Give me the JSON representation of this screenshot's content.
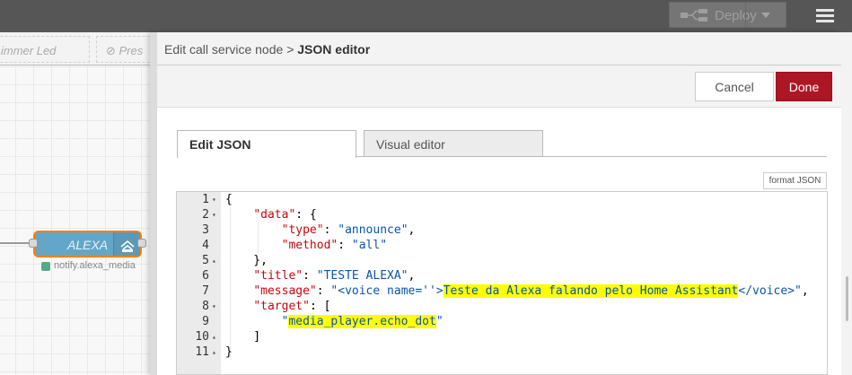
{
  "header": {
    "deploy_label": "Deploy"
  },
  "workspace": {
    "tabs": [
      "immer Led",
      "Pres"
    ],
    "node": {
      "label": "ALEXA",
      "status": "notify.alexa_media"
    }
  },
  "tray": {
    "breadcrumb_prefix": "Edit call service node",
    "breadcrumb_sep": ">",
    "breadcrumb_current": "JSON editor",
    "cancel_label": "Cancel",
    "done_label": "Done",
    "tabs": [
      {
        "label": "Edit JSON",
        "active": true
      },
      {
        "label": "Visual editor",
        "active": false
      }
    ],
    "format_label": "format JSON"
  },
  "editor": {
    "lines": [
      {
        "num": "1",
        "fold": "▾",
        "text": "{"
      },
      {
        "num": "2",
        "fold": "▾",
        "text": "    \"data\": {"
      },
      {
        "num": "3",
        "fold": "",
        "text": "        \"type\": \"announce\","
      },
      {
        "num": "4",
        "fold": "",
        "text": "        \"method\": \"all\""
      },
      {
        "num": "5",
        "fold": "▴",
        "text": "    },"
      },
      {
        "num": "6",
        "fold": "",
        "text": "    \"title\": \"TESTE ALEXA\","
      },
      {
        "num": "7",
        "fold": "",
        "text": "    \"message\": \"<voice name=''>Teste da Alexa falando pelo Home Assistant</voice>\","
      },
      {
        "num": "8",
        "fold": "▾",
        "text": "    \"target\": ["
      },
      {
        "num": "9",
        "fold": "",
        "text": "        \"media_player.echo_dot\""
      },
      {
        "num": "10",
        "fold": "▴",
        "text": "    ]"
      },
      {
        "num": "11",
        "fold": "▴",
        "text": "}"
      }
    ]
  },
  "colors": {
    "header_bg": "#565656",
    "done_bg": "#ad1625",
    "node_fill": "#64a6c7",
    "node_border": "#ff7f0e",
    "json_key": "#c5060b",
    "json_string": "#0a55a8",
    "highlight": "#ffff00"
  }
}
